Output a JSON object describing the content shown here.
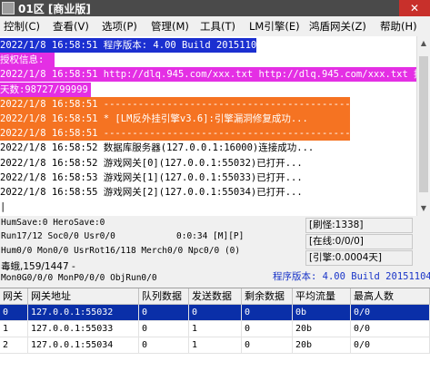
{
  "window": {
    "title": "01区 [商业版]",
    "close_label": "✕"
  },
  "menu": [
    "控制(C)",
    "查看(V)",
    "选项(P)",
    "管理(M)",
    "工具(T)",
    "LM引擎(E)",
    "鸿盾网关(Z)",
    "帮助(H)"
  ],
  "log": [
    {
      "text": "2022/1/8 16:58:51 程序版本: 4.00 Build 20151104",
      "bg": "#1b2fd0",
      "color": "#ffffff"
    },
    {
      "text": "授权信息:",
      "bg": "#e42fe4",
      "color": "#ffffff"
    },
    {
      "text": "2022/1/8 16:58:51 http://dlq.945.com/xxx.txt http://dlq.945.com/xxx.txt 授权",
      "bg": "#e42fe4",
      "color": "#ffffff"
    },
    {
      "text": "天数:98727/99999",
      "bg": "#e42fe4",
      "color": "#ffffff"
    },
    {
      "text": "2022/1/8 16:58:51 ---------------------------------------------------",
      "bg": "#f57322",
      "color": "#ffffff"
    },
    {
      "text": "2022/1/8 16:58:51 * [LM反外挂引擎v3.6]:引擎漏洞修复成功...",
      "bg": "#f57322",
      "color": "#ffffff"
    },
    {
      "text": "2022/1/8 16:58:51 ---------------------------------------------------",
      "bg": "#f57322",
      "color": "#ffffff"
    },
    {
      "text": "2022/1/8 16:58:52 数据库服务器(127.0.0.1:16000)连接成功...",
      "bg": "#ffffff",
      "color": "#000000"
    },
    {
      "text": "2022/1/8 16:58:52 游戏网关[0](127.0.0.1:55032)已打开...",
      "bg": "#ffffff",
      "color": "#000000"
    },
    {
      "text": "2022/1/8 16:58:53 游戏网关[1](127.0.0.1:55033)已打开...",
      "bg": "#ffffff",
      "color": "#000000"
    },
    {
      "text": "2022/1/8 16:58:55 游戏网关[2](127.0.0.1:55034)已打开...",
      "bg": "#ffffff",
      "color": "#000000"
    },
    {
      "text": "|",
      "bg": "#ffffff",
      "color": "#000000"
    }
  ],
  "status": {
    "line1": "HumSave:0 HeroSave:0",
    "line2": "Run17/12 Soc0/0 Usr0/0",
    "line2b": "0:0:34 [M][P]",
    "line3": "Hum0/0 Mon0/0 UsrRot16/118 Merch0/0 Npc0/0 (0)",
    "line4": "毒蛾,159/1447 -",
    "line5": "Mon0G0/0/0 MonP0/0/0 ObjRun0/0",
    "box1": "[刷怪:1338]",
    "box2": "[在线:0/0/0]",
    "box3": "[引擎:0.0004天]",
    "version": "程序版本: 4.00 Build 20151104"
  },
  "table": {
    "headers": [
      "网关",
      "网关地址",
      "队列数据",
      "发送数据",
      "剩余数据",
      "平均流量",
      "最高人数"
    ],
    "rows": [
      [
        "0",
        "127.0.0.1:55032",
        "0",
        "0",
        "0",
        "0b",
        "0/0"
      ],
      [
        "1",
        "127.0.0.1:55033",
        "0",
        "1",
        "0",
        "20b",
        "0/0"
      ],
      [
        "2",
        "127.0.0.1:55034",
        "0",
        "1",
        "0",
        "20b",
        "0/0"
      ]
    ],
    "selected_row": 0
  }
}
